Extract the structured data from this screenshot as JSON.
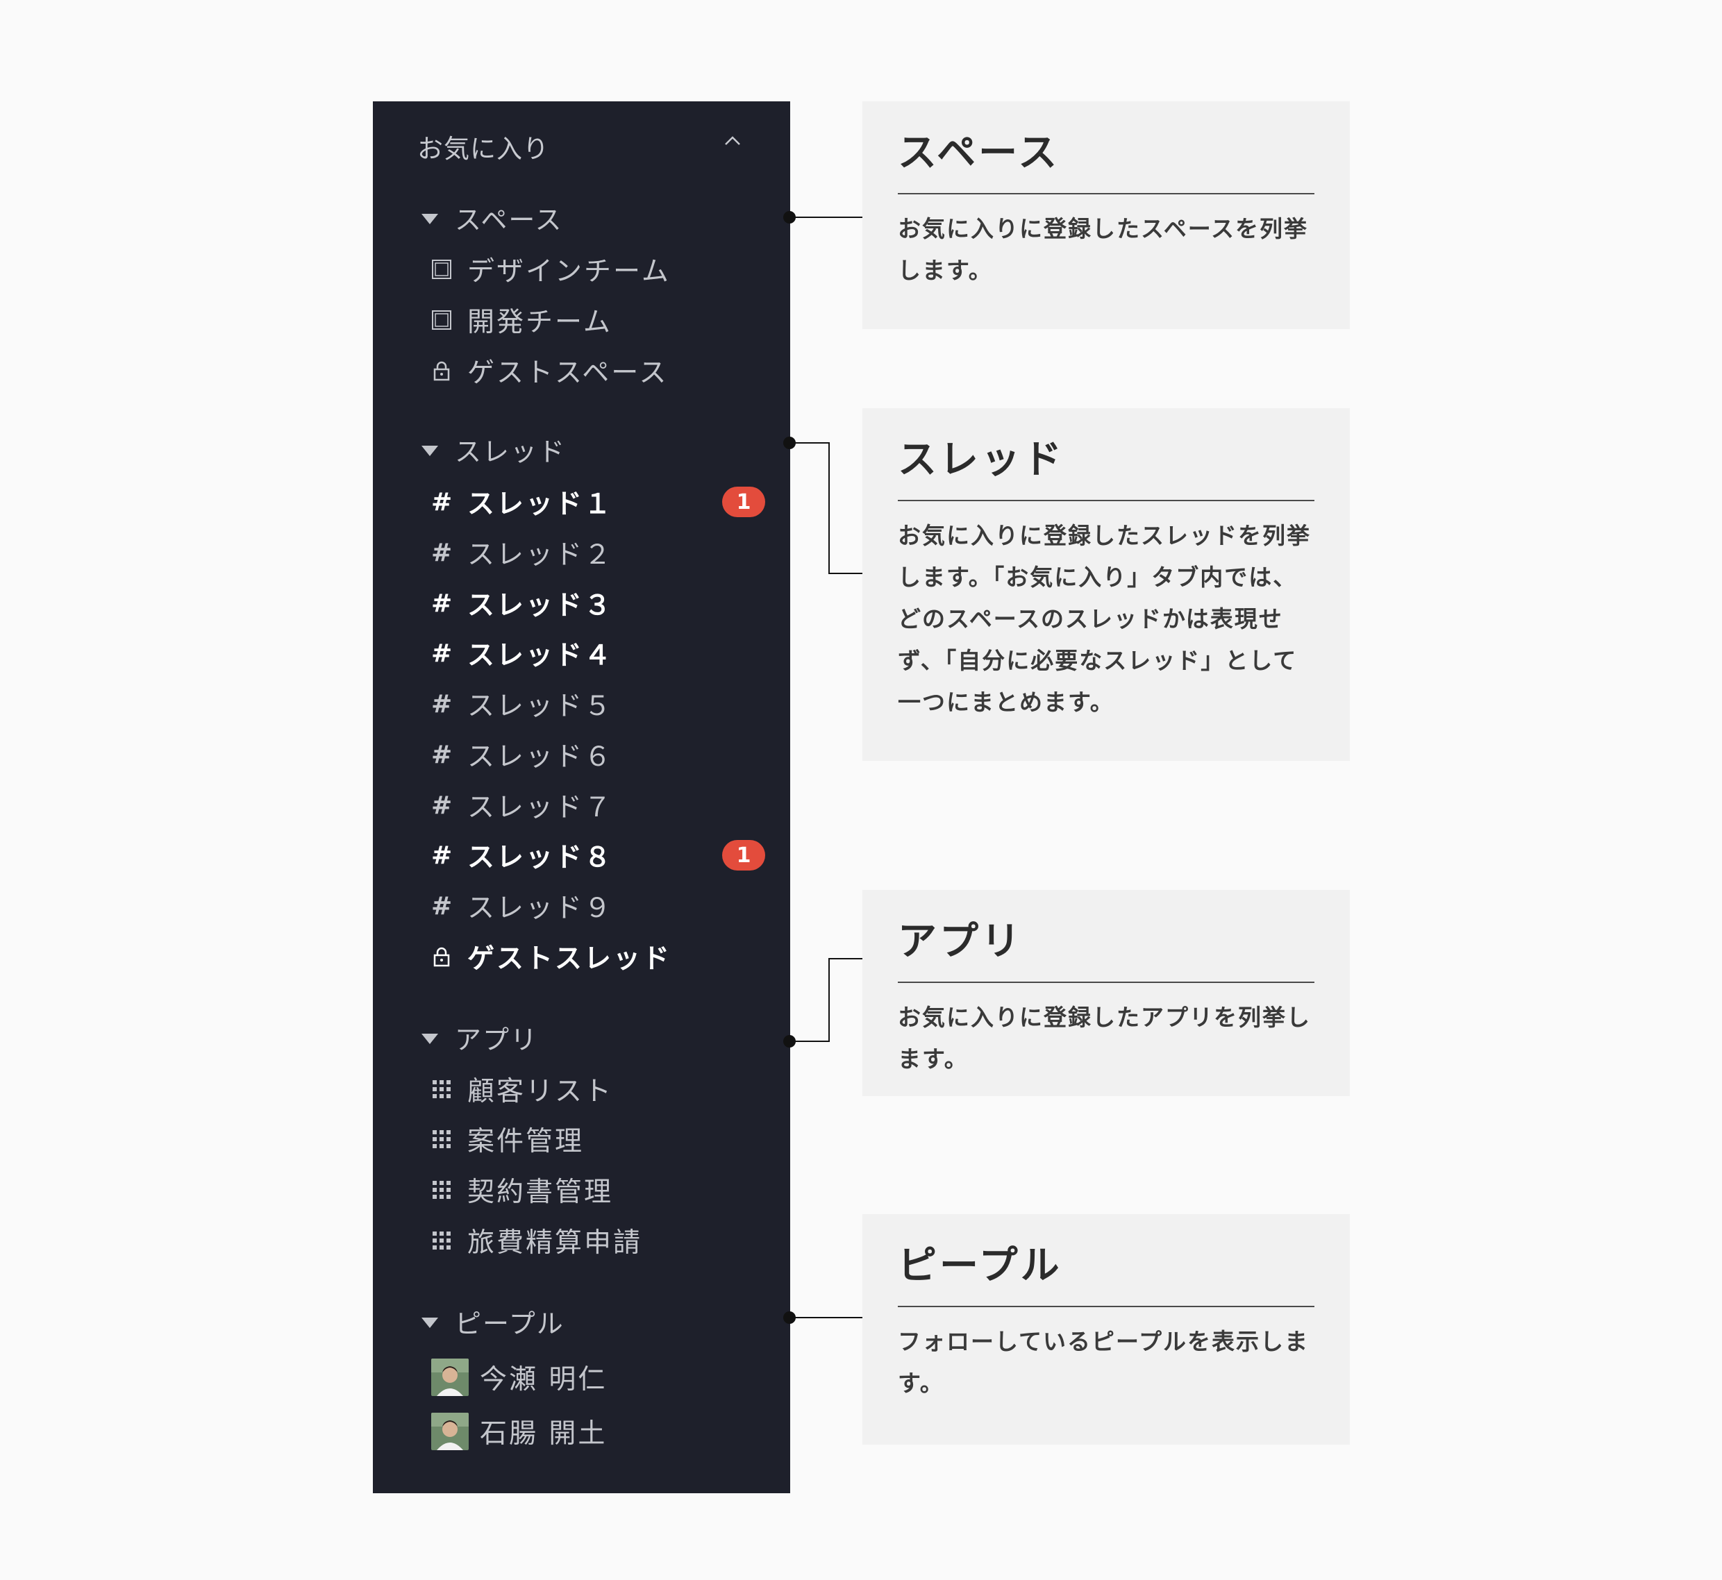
{
  "sidebar": {
    "favorites_label": "お気に入り",
    "sections": {
      "spaces": {
        "label": "スペース",
        "items": [
          "デザインチーム",
          "開発チーム",
          "ゲストスペース"
        ]
      },
      "threads": {
        "label": "スレッド",
        "items": [
          {
            "label": "スレッド１",
            "unread": true,
            "badge": "1"
          },
          {
            "label": "スレッド２",
            "unread": false
          },
          {
            "label": "スレッド３",
            "unread": true
          },
          {
            "label": "スレッド４",
            "unread": true
          },
          {
            "label": "スレッド５",
            "unread": false
          },
          {
            "label": "スレッド６",
            "unread": false
          },
          {
            "label": "スレッド７",
            "unread": false
          },
          {
            "label": "スレッド８",
            "unread": true,
            "badge": "1"
          },
          {
            "label": "スレッド９",
            "unread": false
          },
          {
            "label": "ゲストスレッド",
            "unread": true,
            "locked": true
          }
        ]
      },
      "apps": {
        "label": "アプリ",
        "items": [
          "顧客リスト",
          "案件管理",
          "契約書管理",
          "旅費精算申請"
        ]
      },
      "people": {
        "label": "ピープル",
        "items": [
          "今瀬 明仁",
          "石腸 開土"
        ]
      }
    }
  },
  "annotations": {
    "spaces": {
      "title": "スペース",
      "body": "お気に入りに登録したスペースを列挙します。"
    },
    "threads": {
      "title": "スレッド",
      "body": "お気に入りに登録したスレッドを列挙します。「お気に入り」タブ内では、どのスペースのスレッドかは表現せず、「自分に必要なスレッド」として一つにまとめます。"
    },
    "apps": {
      "title": "アプリ",
      "body": "お気に入りに登録したアプリを列挙します。"
    },
    "people": {
      "title": "ピープル",
      "body": "フォローしているピープルを表示します。"
    }
  },
  "colors": {
    "sidebar_bg": "#1e202b",
    "badge": "#e34c3c",
    "card_bg": "#f1f1f1",
    "page_bg": "#fafafa"
  },
  "icons": {
    "space": "space-square-icon",
    "guest": "lock-icon",
    "thread": "hash-icon",
    "app": "grid-icon",
    "collapse": "chevron-up-icon",
    "section": "caret-down-icon"
  }
}
